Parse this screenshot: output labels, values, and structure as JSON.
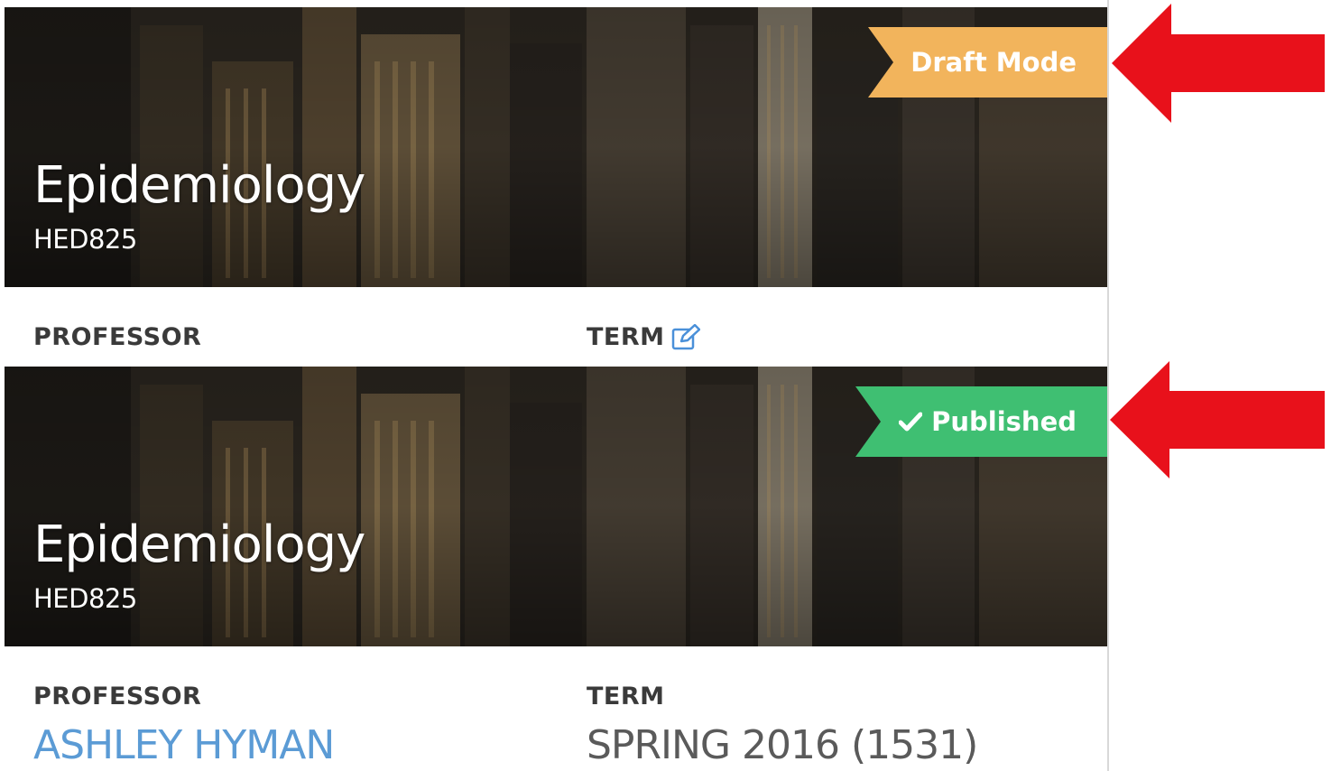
{
  "cards": [
    {
      "title": "Epidemiology",
      "code": "HED825",
      "status_label": "Draft Mode",
      "status_color": "#f2b45c",
      "professor_label": "PROFESSOR",
      "term_label": "TERM",
      "term_edit_icon": "edit-icon"
    },
    {
      "title": "Epidemiology",
      "code": "HED825",
      "status_label": "Published",
      "status_icon": "check-icon",
      "status_color": "#3fbf72",
      "professor_label": "PROFESSOR",
      "professor_name": "ASHLEY HYMAN",
      "term_label": "TERM",
      "term_value": "SPRING 2016 (1531)"
    }
  ],
  "annotations": {
    "arrow_color": "#e8111b",
    "arrows": [
      "arrow-left-icon",
      "arrow-left-icon"
    ]
  },
  "colors": {
    "link": "#5b9bd5",
    "label": "#3a3a3a"
  }
}
